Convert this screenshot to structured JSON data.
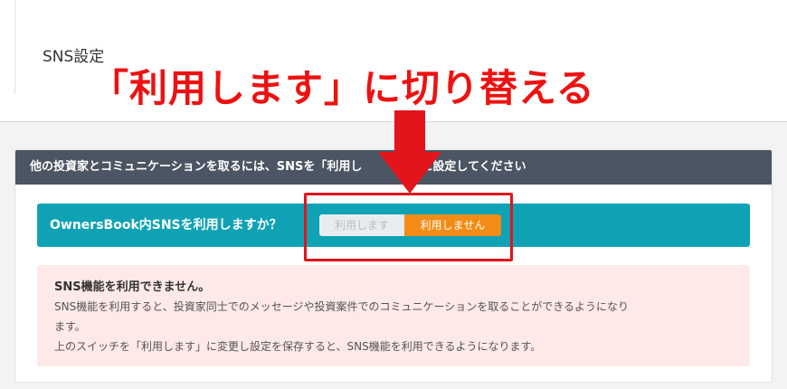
{
  "page": {
    "title": "SNS設定"
  },
  "annotation": {
    "headline": "「利用します」に切り替える",
    "arrow_icon": "down-arrow-icon",
    "accent_color": "#ee1111"
  },
  "card": {
    "header_text": "他の投資家とコミュニケーションを取るには、SNSを「利用し　　　　」に設定してください",
    "question": "OwnersBook内SNSを利用しますか？",
    "switch": {
      "option_use": "利用します",
      "option_no_use": "利用しません",
      "selected": "利用しません"
    },
    "notice": {
      "title": "SNS機能を利用できません。",
      "body_line1": "SNS機能を利用すると、投資家同士でのメッセージや投資案件でのコミュニケーションを取ることができるようになり",
      "body_line2": "ます。",
      "body_line3": "上のスイッチを「利用します」に変更し設定を保存すると、SNS機能を利用できるようになります。"
    }
  },
  "colors": {
    "header_bg": "#4b5563",
    "teal": "#0fa2b5",
    "orange": "#f28c17",
    "notice_bg": "#fde9e7"
  }
}
